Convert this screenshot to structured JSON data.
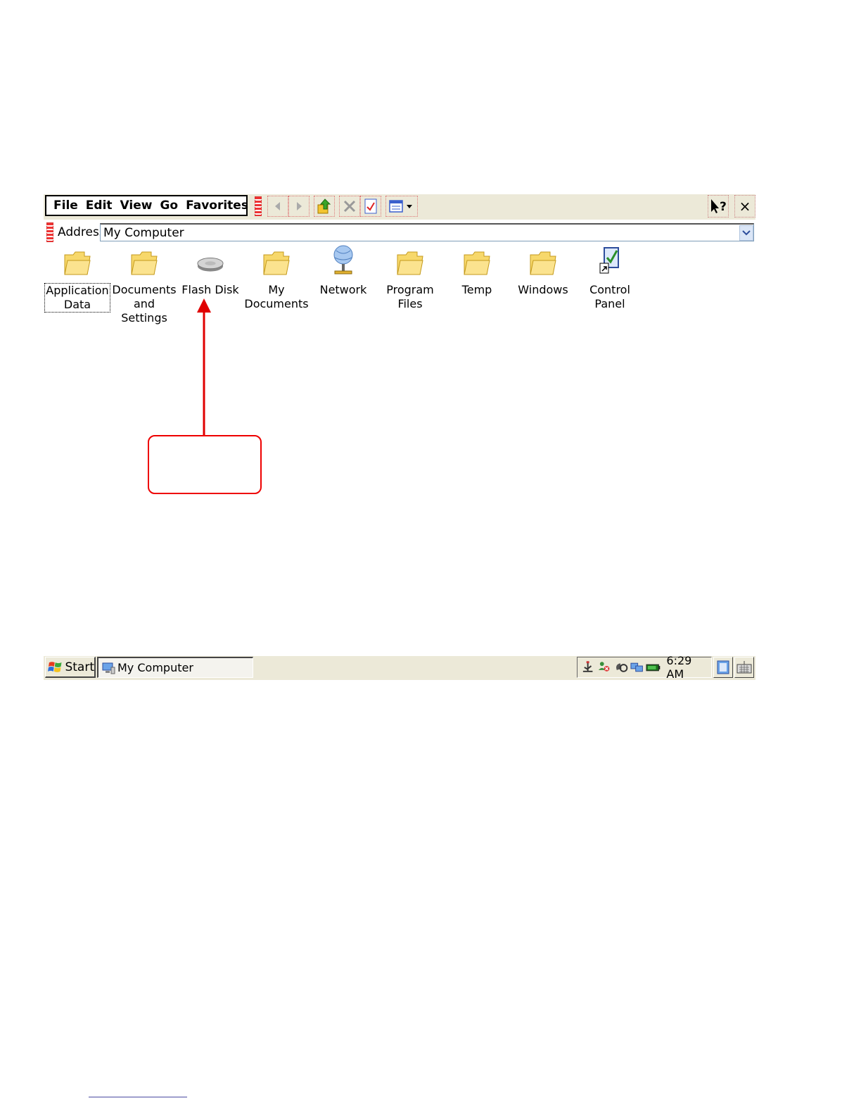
{
  "menu": {
    "items": [
      "File",
      "Edit",
      "View",
      "Go",
      "Favorites"
    ]
  },
  "toolbar": {
    "back_icon": "back-arrow-icon",
    "forward_icon": "forward-arrow-icon",
    "up_icon": "up-folder-icon",
    "delete_icon": "delete-x-icon",
    "properties_icon": "properties-icon",
    "views_icon": "views-dropdown-icon",
    "help_label": "?",
    "close_label": "×"
  },
  "address": {
    "label": "Address",
    "value": "My Computer"
  },
  "folders": [
    {
      "label": "Application\nData",
      "icon": "folder-icon",
      "selected": true
    },
    {
      "label": "Documents\nand Settings",
      "icon": "folder-icon"
    },
    {
      "label": "Flash Disk",
      "icon": "drive-icon"
    },
    {
      "label": "My\nDocuments",
      "icon": "folder-icon"
    },
    {
      "label": "Network",
      "icon": "network-icon"
    },
    {
      "label": "Program Files",
      "icon": "folder-icon"
    },
    {
      "label": "Temp",
      "icon": "folder-icon"
    },
    {
      "label": "Windows",
      "icon": "folder-icon"
    },
    {
      "label": "Control\nPanel",
      "icon": "control-panel-icon"
    }
  ],
  "taskbar": {
    "start_label": "Start",
    "task_label": "My Computer",
    "clock": "6:29 AM"
  },
  "colors": {
    "accent_red": "#e00000",
    "toolbar_bg": "#ece9d8",
    "folder_yellow": "#f7d86b"
  }
}
